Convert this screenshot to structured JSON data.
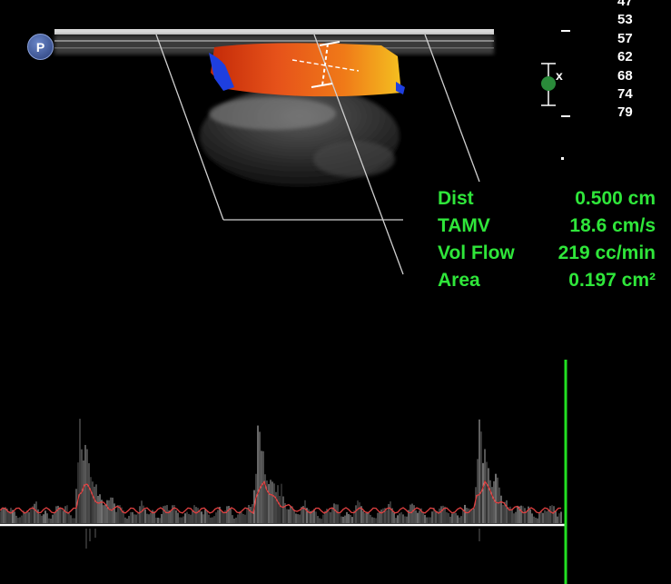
{
  "logo": {
    "label": "P"
  },
  "depth_scale": [
    "47",
    "53",
    "57",
    "62",
    "68",
    "74",
    "79"
  ],
  "focus_marker": {
    "label": "x"
  },
  "measurements": [
    {
      "name": "Dist",
      "value": "0.500 cm"
    },
    {
      "name": "TAMV",
      "value": "18.6 cm/s"
    },
    {
      "name": "Vol Flow",
      "value": "219 cc/min"
    },
    {
      "name": "Area",
      "value": "0.197 cm²"
    }
  ],
  "colors": {
    "measurement_text": "#2fe63a",
    "flow_forward": "#e85a10",
    "flow_reverse": "#1e3fe0",
    "envelope_trace": "#e04040",
    "cursor_line": "#22e022"
  },
  "doppler": {
    "peaks": 3
  }
}
